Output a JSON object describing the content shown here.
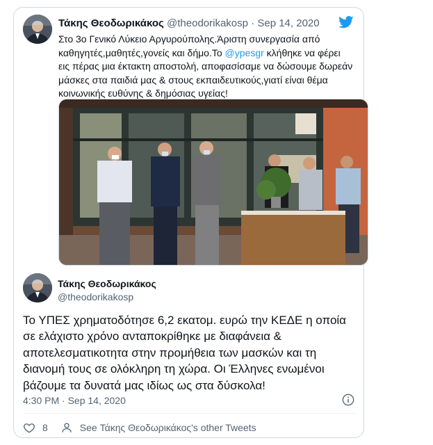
{
  "quoted_tweet": {
    "name": "Τάκης Θεοδωρικάκος",
    "handle": "@theodorikakosp",
    "separator": "·",
    "date": "Sep 14, 2020",
    "text_before_mention": "Στο 3ο Γενικό Λύκειο Αργυρούπολης.Άριστη συνεργασία από καθηγητές,μαθητές,γονείς και δήμο.Το ",
    "mention": "@ypesgr",
    "text_after_mention": " κλήθηκε να φέρει εις πέρας μια έκτακτη αποστολή, αποφασίσαμε να δώσουμε δωρεάν μάσκες στα παιδιά μας & στους εκπαιδευτικούς,γιατί είναι θέμα κοινωνικής ευθύνης & δημόσιας υγείας!"
  },
  "main_tweet": {
    "name": "Τάκης Θεοδωρικάκος",
    "handle": "@theodorikakosp",
    "text": "Το ΥΠΕΣ χρηματοδότησε 6,2 εκατομ. ευρώ την ΚΕΔΕ η οποία σε ελάχιστο χρόνο ανταποκρίθηκε με διαφάνεια & αποτελεσματικοτητα στην προμήθεια των μασκών και τη διανομή τους σε ολόκληρη τη χώρα. Οι Έλληνες ενωμένοι βάζουμε τα δυνατά μας ιδίως ως στα δύσκολα!",
    "timestamp": "4:30 PM · Sep 14, 2020",
    "like_count": "8",
    "other_tweets_link": "See Τάκης Θεοδωρικάκος's other Tweets"
  },
  "icons": {
    "platform": "twitter-bird-icon",
    "info": "info-icon",
    "like": "heart-icon",
    "profile": "person-icon"
  },
  "colors": {
    "accent": "#1d9bf0",
    "text": "#0f1419",
    "secondary": "#536471"
  }
}
